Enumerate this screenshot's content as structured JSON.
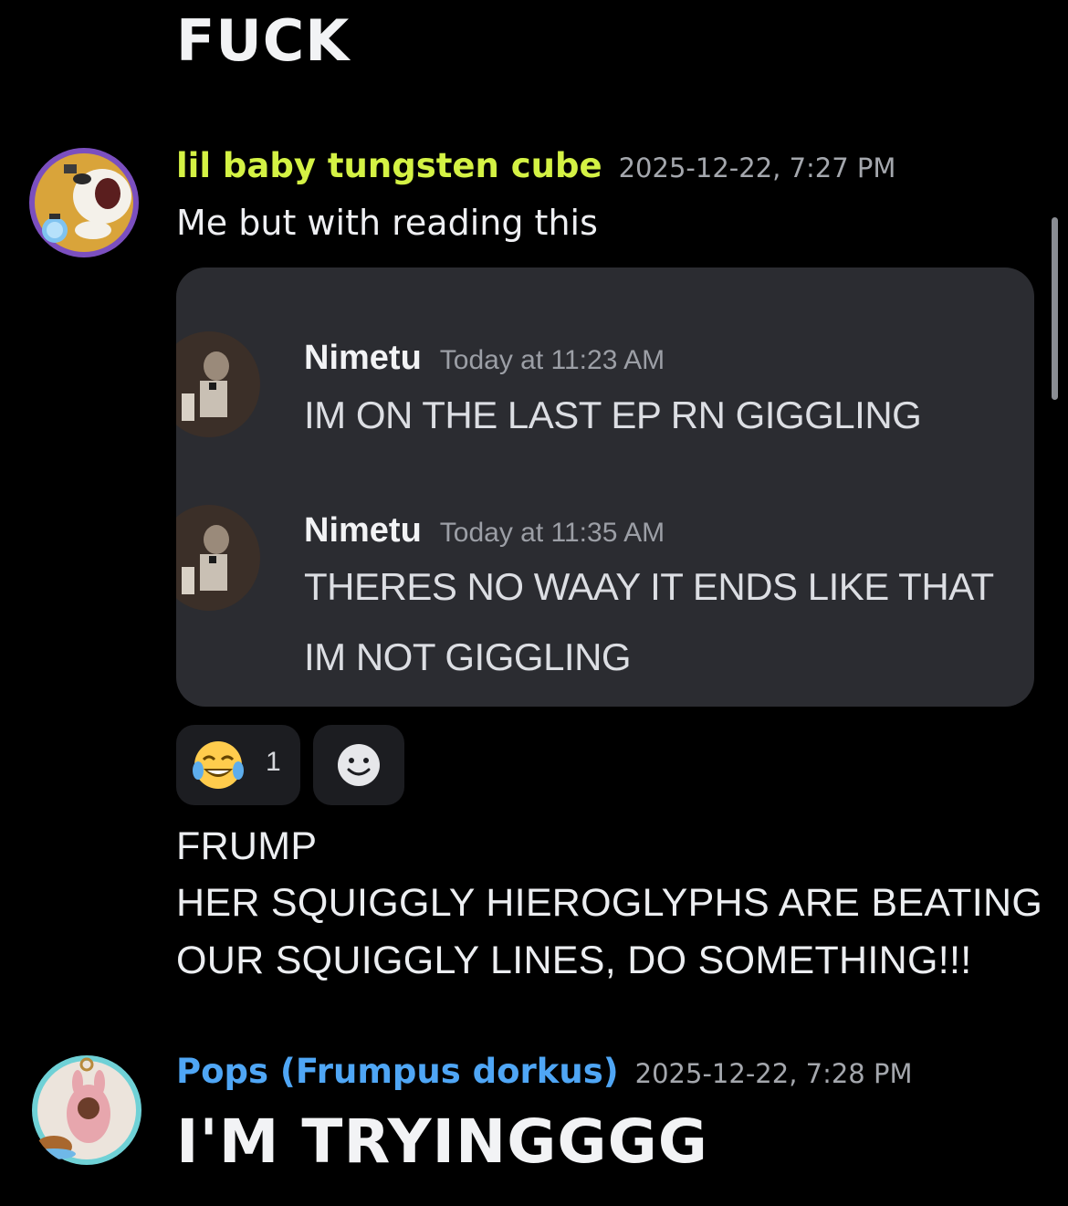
{
  "previous_message": {
    "text": "FUCK"
  },
  "message1": {
    "username": "lil baby tungsten cube",
    "username_color": "#d4f244",
    "timestamp": "2025-12-22, 7:27 PM",
    "text": "Me but with reading this",
    "embed": {
      "messages": [
        {
          "name": "Nimetu",
          "time": "Today at 11:23 AM",
          "lines": [
            "IM ON THE LAST EP RN GIGGLING"
          ]
        },
        {
          "name": "Nimetu",
          "time": "Today at 11:35 AM",
          "lines": [
            "THERES NO WAAY IT ENDS LIKE THAT",
            "IM NOT GIGGLING"
          ]
        }
      ]
    },
    "reactions": [
      {
        "emoji": "joy-emoji",
        "count": "1"
      }
    ],
    "add_reaction_icon": "smiley-add-reaction-icon"
  },
  "message2": {
    "lines": [
      "FRUMP",
      "HER SQUIGGLY HIEROGLYPHS ARE BEATING",
      "OUR SQUIGGLY LINES, DO SOMETHING!!!"
    ]
  },
  "message3": {
    "username": "Pops (Frumpus dorkus)",
    "username_color": "#4fa6f5",
    "timestamp": "2025-12-22, 7:28 PM",
    "text": "I'M TRYINGGGG"
  }
}
